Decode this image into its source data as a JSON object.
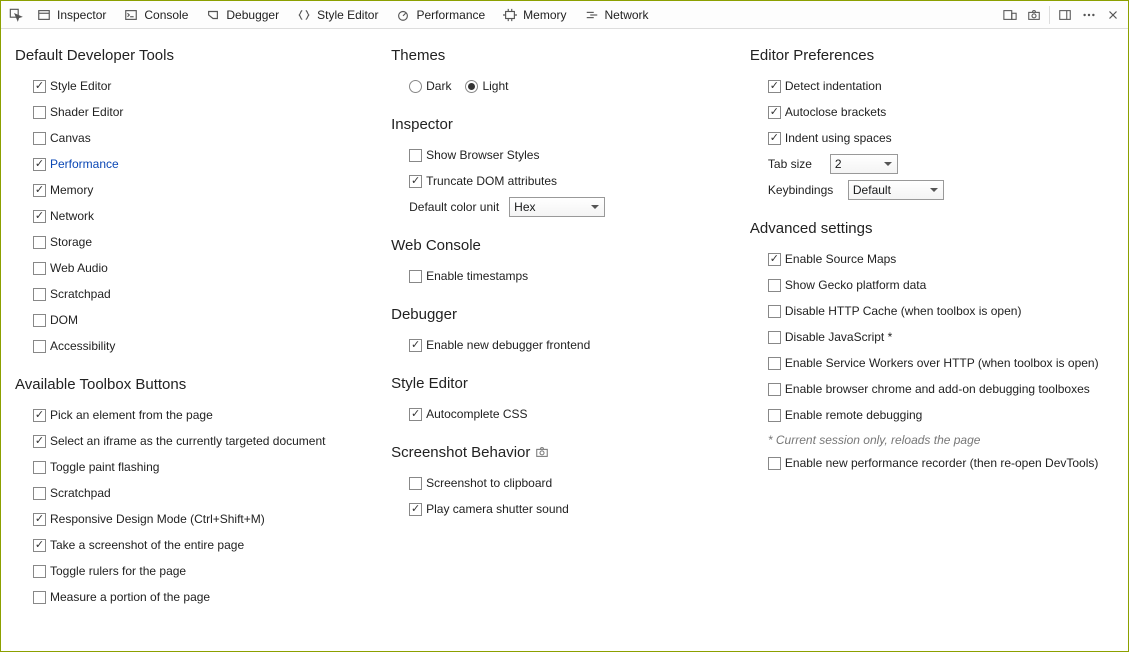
{
  "toolbar": {
    "tabs": [
      "Inspector",
      "Console",
      "Debugger",
      "Style Editor",
      "Performance",
      "Memory",
      "Network"
    ]
  },
  "col1": {
    "h_default": "Default Developer Tools",
    "tools": [
      {
        "label": "Style Editor",
        "checked": true
      },
      {
        "label": "Shader Editor",
        "checked": false
      },
      {
        "label": "Canvas",
        "checked": false
      },
      {
        "label": "Performance",
        "checked": true,
        "hl": true
      },
      {
        "label": "Memory",
        "checked": true
      },
      {
        "label": "Network",
        "checked": true
      },
      {
        "label": "Storage",
        "checked": false
      },
      {
        "label": "Web Audio",
        "checked": false
      },
      {
        "label": "Scratchpad",
        "checked": false
      },
      {
        "label": "DOM",
        "checked": false
      },
      {
        "label": "Accessibility",
        "checked": false
      }
    ],
    "h_buttons": "Available Toolbox Buttons",
    "buttons": [
      {
        "label": "Pick an element from the page",
        "checked": true
      },
      {
        "label": "Select an iframe as the currently targeted document",
        "checked": true
      },
      {
        "label": "Toggle paint flashing",
        "checked": false
      },
      {
        "label": "Scratchpad",
        "checked": false
      },
      {
        "label": "Responsive Design Mode (Ctrl+Shift+M)",
        "checked": true
      },
      {
        "label": "Take a screenshot of the entire page",
        "checked": true
      },
      {
        "label": "Toggle rulers for the page",
        "checked": false
      },
      {
        "label": "Measure a portion of the page",
        "checked": false
      }
    ]
  },
  "col2": {
    "h_themes": "Themes",
    "theme_dark": "Dark",
    "theme_light": "Light",
    "theme_sel": "light",
    "h_inspector": "Inspector",
    "insp": [
      {
        "label": "Show Browser Styles",
        "checked": false
      },
      {
        "label": "Truncate DOM attributes",
        "checked": true
      }
    ],
    "colorunit_label": "Default color unit",
    "colorunit_value": "Hex",
    "h_webconsole": "Web Console",
    "wc": [
      {
        "label": "Enable timestamps",
        "checked": false
      }
    ],
    "h_debugger": "Debugger",
    "dbg": [
      {
        "label": "Enable new debugger frontend",
        "checked": true
      }
    ],
    "h_styleedit": "Style Editor",
    "se": [
      {
        "label": "Autocomplete CSS",
        "checked": true
      }
    ],
    "h_screenshot": "Screenshot Behavior",
    "ss": [
      {
        "label": "Screenshot to clipboard",
        "checked": false
      },
      {
        "label": "Play camera shutter sound",
        "checked": true
      }
    ]
  },
  "col3": {
    "h_editor": "Editor Preferences",
    "ed": [
      {
        "label": "Detect indentation",
        "checked": true
      },
      {
        "label": "Autoclose brackets",
        "checked": true
      },
      {
        "label": "Indent using spaces",
        "checked": true
      }
    ],
    "tabsize_label": "Tab size",
    "tabsize_value": "2",
    "keybind_label": "Keybindings",
    "keybind_value": "Default",
    "h_adv": "Advanced settings",
    "adv": [
      {
        "label": "Enable Source Maps",
        "checked": true
      },
      {
        "label": "Show Gecko platform data",
        "checked": false
      },
      {
        "label": "Disable HTTP Cache (when toolbox is open)",
        "checked": false
      },
      {
        "label": "Disable JavaScript *",
        "checked": false
      },
      {
        "label": "Enable Service Workers over HTTP (when toolbox is open)",
        "checked": false
      },
      {
        "label": "Enable browser chrome and add-on debugging toolboxes",
        "checked": false
      },
      {
        "label": "Enable remote debugging",
        "checked": false
      }
    ],
    "footnote": "* Current session only, reloads the page",
    "adv2": [
      {
        "label": "Enable new performance recorder (then re-open DevTools)",
        "checked": false
      }
    ]
  }
}
